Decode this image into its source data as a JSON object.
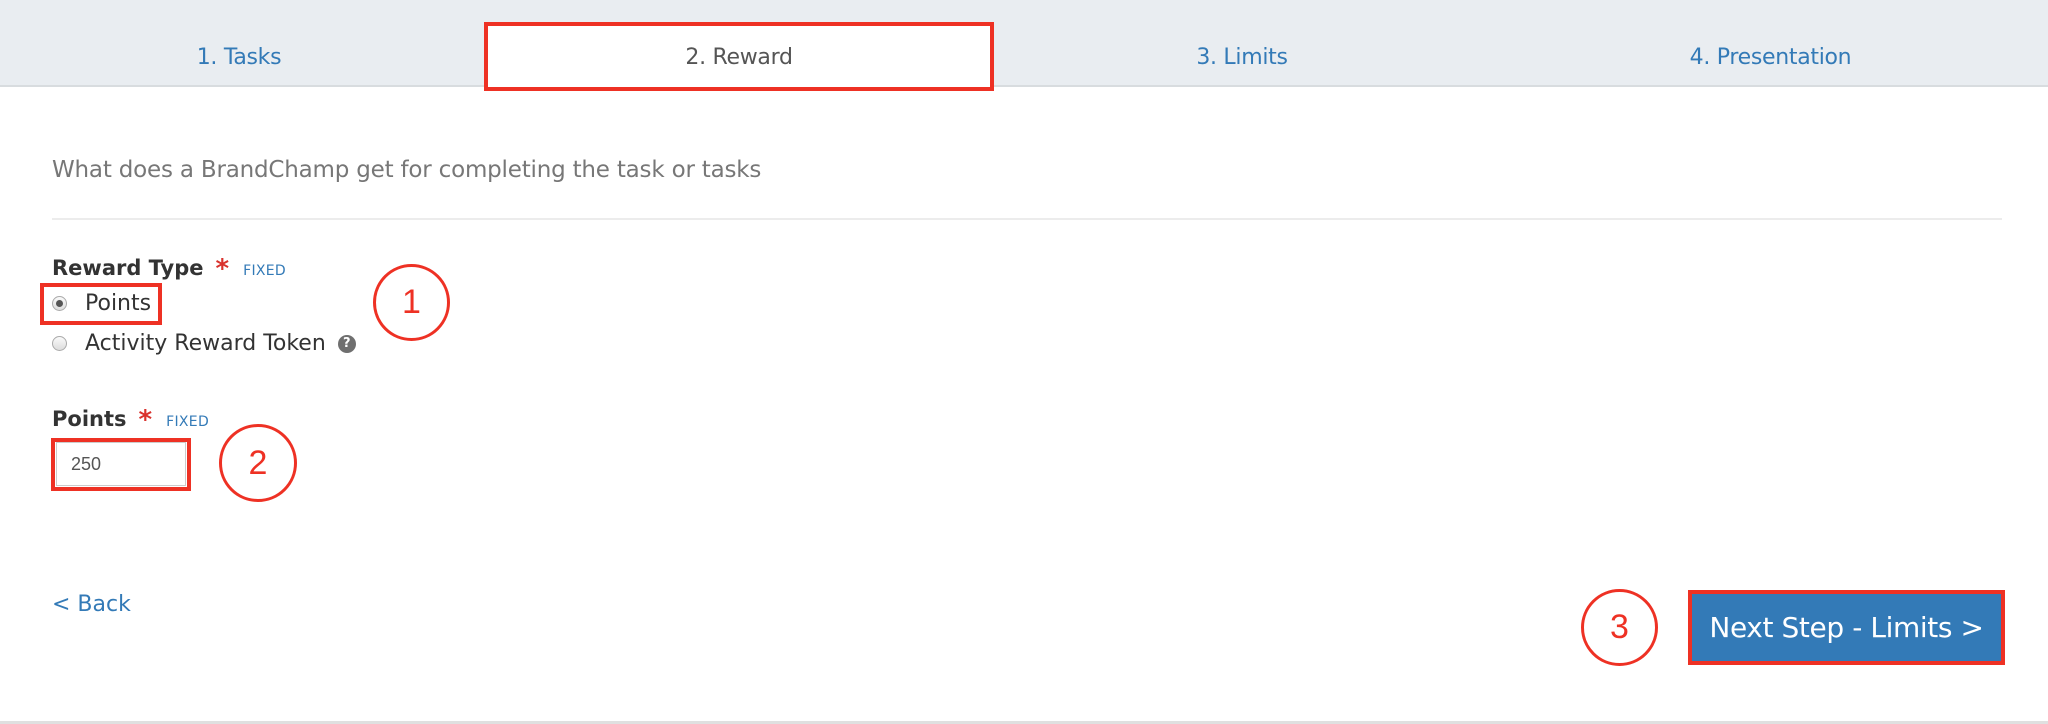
{
  "tabs": [
    {
      "label": "1. Tasks",
      "active": false
    },
    {
      "label": "2. Reward",
      "active": true
    },
    {
      "label": "3. Limits",
      "active": false
    },
    {
      "label": "4. Presentation",
      "active": false
    }
  ],
  "form": {
    "subtitle": "What does a BrandChamp get for completing the task or tasks",
    "reward_type": {
      "label": "Reward Type",
      "required_mark": "*",
      "badge": "FIXED",
      "options": [
        {
          "label": "Points",
          "selected": true
        },
        {
          "label": "Activity Reward Token",
          "selected": false,
          "help_icon": "question-circle-icon"
        }
      ],
      "help_glyph": "?"
    },
    "points": {
      "label": "Points",
      "required_mark": "*",
      "badge": "FIXED",
      "value": "250"
    }
  },
  "footer": {
    "back_label": "< Back",
    "next_label": "Next Step - Limits >"
  },
  "annotations": {
    "markers": [
      "1",
      "2",
      "3"
    ],
    "color": "#ee3124"
  },
  "colors": {
    "accent": "#337ab7",
    "tabbar_bg": "#e9edf1",
    "required": "#d9322d"
  }
}
